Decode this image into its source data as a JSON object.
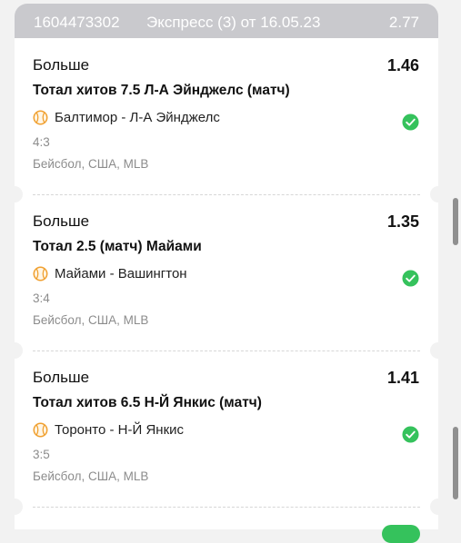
{
  "bet": {
    "id": "1604473302",
    "title": "Экспресс (3) от 16.05.23",
    "total_odds": "2.77"
  },
  "events": [
    {
      "selection": "Больше",
      "odds": "1.46",
      "market": "Тотал хитов 7.5  Л-А Эйнджелс  (матч)",
      "teams": "Балтимор - Л-А Эйнджелс",
      "score": "4:3",
      "league": "Бейсбол, США, MLB",
      "status_icon": "check-circle-icon"
    },
    {
      "selection": "Больше",
      "odds": "1.35",
      "market": "Тотал 2.5 (матч)  Майами",
      "teams": "Майами - Вашингтон",
      "score": "3:4",
      "league": "Бейсбол, США, MLB",
      "status_icon": "check-circle-icon"
    },
    {
      "selection": "Больше",
      "odds": "1.41",
      "market": "Тотал хитов 6.5  Н-Й Янкис  (матч)",
      "teams": "Торонто - Н-Й Янкис",
      "score": "3:5",
      "league": "Бейсбол, США, MLB",
      "status_icon": "check-circle-icon"
    }
  ],
  "colors": {
    "header_bg": "#c9c9cd",
    "win_green": "#35c25c",
    "sport_icon_orange": "#f0a030",
    "muted_text": "#8c8c8c"
  }
}
